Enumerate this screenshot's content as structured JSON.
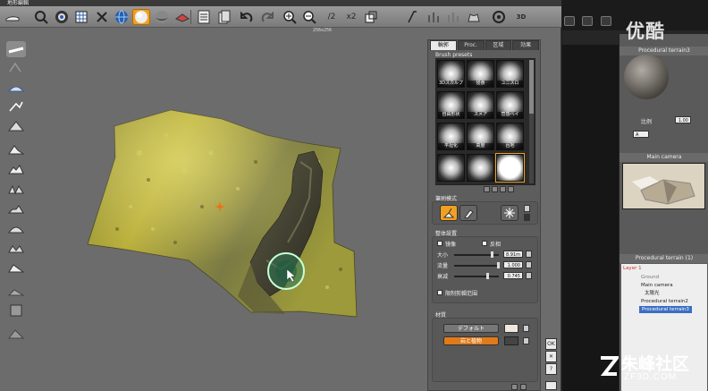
{
  "window": {
    "title": "地形編輯"
  },
  "viewport": {
    "coordinate_readout": "256x256"
  },
  "toolbar": {
    "icons": [
      "terrain-icon",
      "zoom-fit-icon",
      "smooth-icon",
      "grid-icon",
      "globe-icon",
      "sphere-shaded-icon",
      "sphere-icon",
      "terrain-view-icon",
      "list-icon",
      "copy-icon",
      "undo-icon",
      "redo-icon",
      "zoom-in-icon",
      "zoom-out-icon",
      "half-icon",
      "double-icon",
      "resize-icon",
      "lathe-icon",
      "plants-icon",
      "paint-icon",
      "raise-icon",
      "settings-icon",
      "3d-icon"
    ],
    "half_label": "/2",
    "double_label": "x2",
    "threed_label": "3D"
  },
  "panel": {
    "tabs": [
      "輪郭",
      "Proc.",
      "区域",
      "効果"
    ],
    "active_tab": 0,
    "brush_presets_title": "Brush presets",
    "presets": [
      "3Dスカルプ",
      "侵食",
      "ユニスロ",
      "自由形状",
      "スメア",
      "菅感ベイ",
      "平坦化",
      "高度",
      "台地",
      "",
      "",
      ""
    ],
    "selected_preset": 11,
    "brush_mode_title": "筆刷模式",
    "overall_title": "整体設置",
    "symmetry_label": "镜像",
    "invert_label": "反相",
    "size_label": "大小",
    "size_value": "8.91m",
    "size_level": 0.85,
    "flow_label": "流量",
    "flow_value": "1.000",
    "flow_level": 1.0,
    "falloff_label": "衰减",
    "falloff_value": "0.745",
    "falloff_level": 0.745,
    "limit_label": "限制剪輯范围",
    "material_title": "材質",
    "default_button": "デフォルト",
    "rock_button": "岩と植物"
  },
  "okstrip": {
    "ok": "OK",
    "close": "✕",
    "help": "?"
  },
  "main": {
    "material_title": "Procedural terrain3",
    "scale_label": "10m",
    "ratio_label": "比例",
    "ratio_value": "1.00",
    "ratio_dropdown": "A",
    "camera_title": "Main camera",
    "tree_title": "Procedural terrain (1)",
    "tree_items": [
      {
        "label": "Layer 1",
        "selected": false
      },
      {
        "label": "Ground",
        "selected": false
      },
      {
        "label": "Main camera",
        "selected": false
      },
      {
        "label": "太陽光",
        "selected": false
      },
      {
        "label": "Procedural terrain2",
        "selected": false
      },
      {
        "label": "Procedural terrain3",
        "selected": true
      }
    ]
  },
  "watermarks": {
    "top": "优酷",
    "bottom": "朱峰社区",
    "bottom_sub": "ZF3D.COM"
  },
  "colors": {
    "accent": "#f0a020",
    "selection": "#3a6ec2",
    "terrain_yellow": "#b8b03a"
  }
}
